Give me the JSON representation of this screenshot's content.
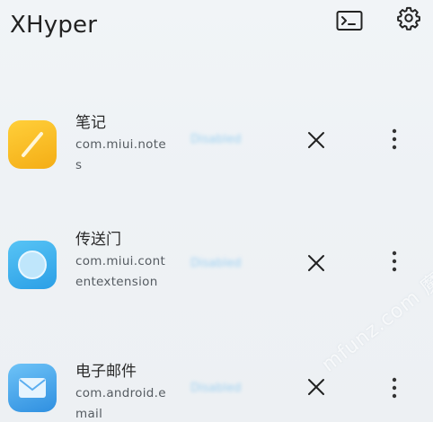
{
  "header": {
    "title": "XHyper",
    "terminal_icon": "terminal-icon",
    "settings_icon": "gear-icon"
  },
  "apps": [
    {
      "name": "笔记",
      "package": "com.miui.notes",
      "status": "Disabled",
      "icon": "notes-app-icon",
      "icon_color": "#f4b41e"
    },
    {
      "name": "传送门",
      "package": "com.miui.contentextension",
      "status": "Disabled",
      "icon": "portal-app-icon",
      "icon_color": "#3aaaf0"
    },
    {
      "name": "电子邮件",
      "package": "com.android.email",
      "status": "Disabled",
      "icon": "email-app-icon",
      "icon_color": "#4aa7ec"
    }
  ],
  "watermark": "mfunz.com 魔趣网"
}
